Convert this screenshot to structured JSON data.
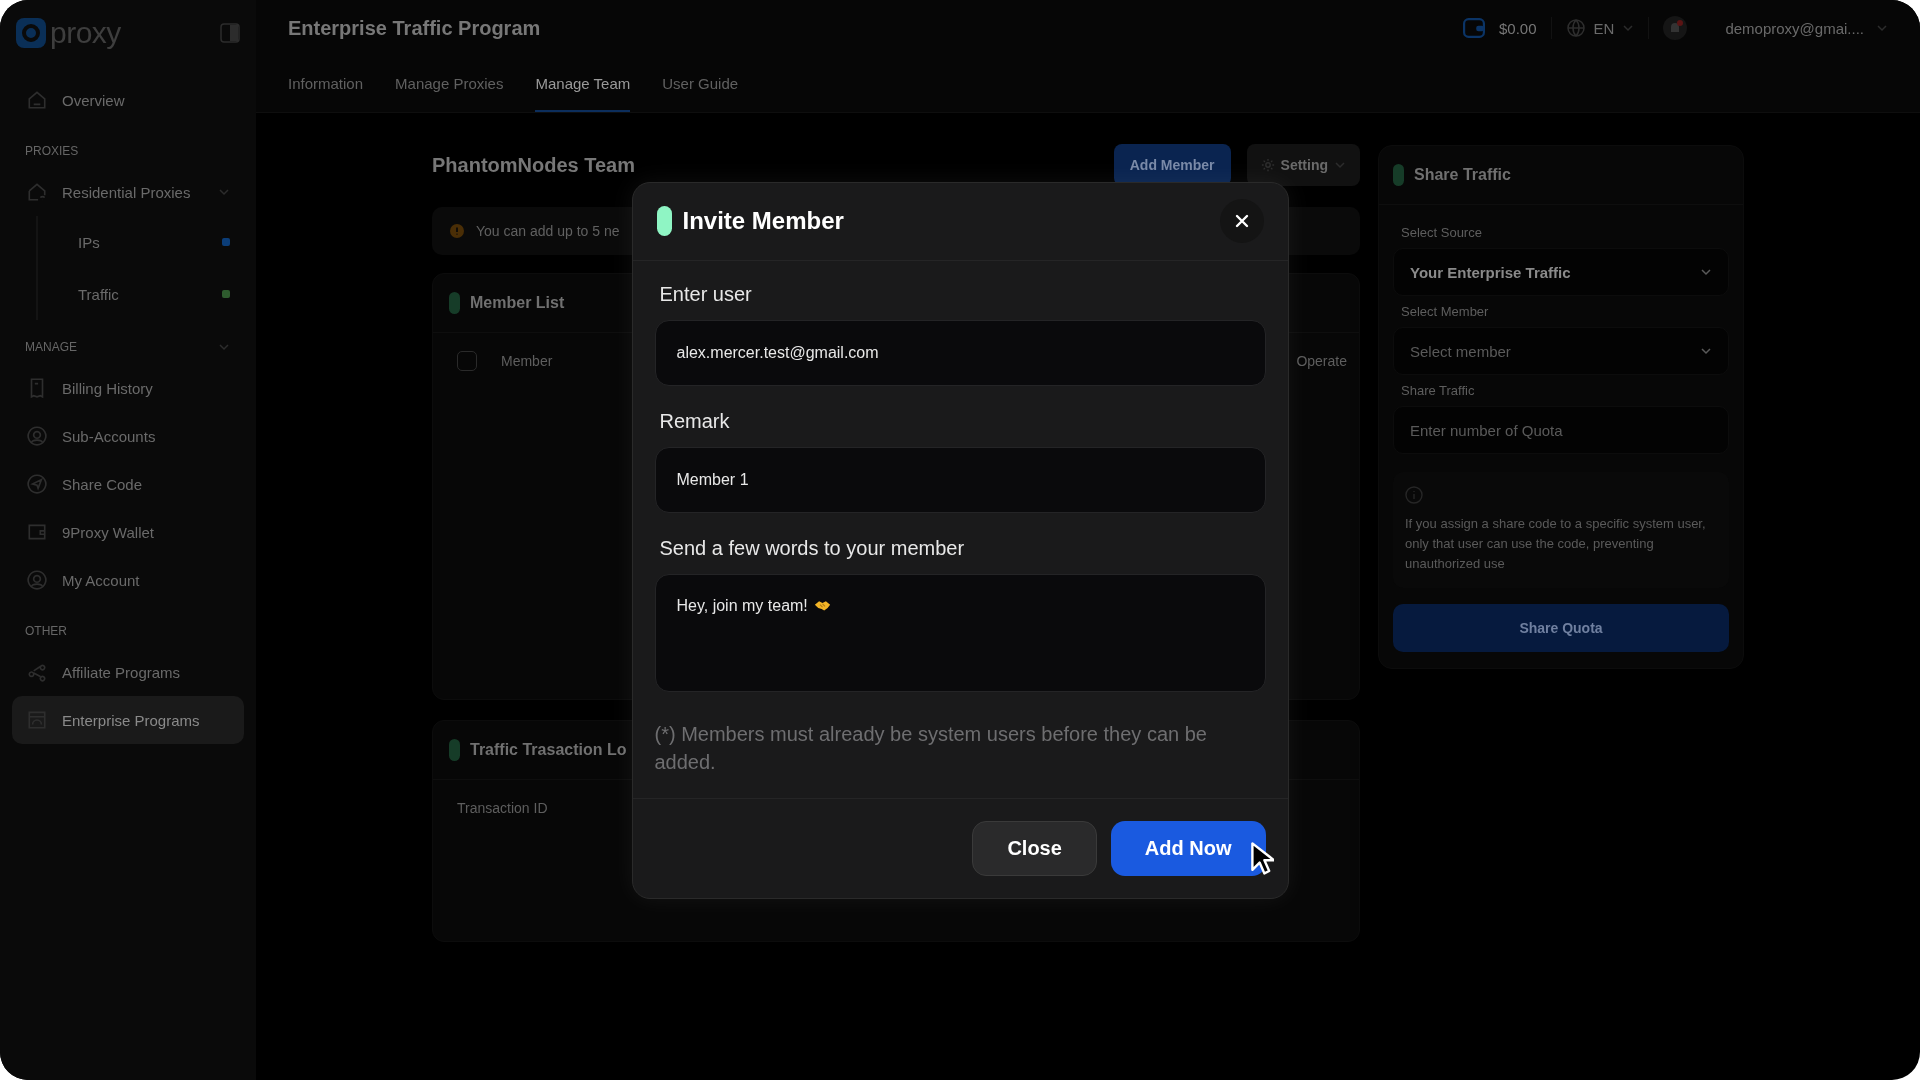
{
  "sidebar": {
    "logo": "proxy",
    "items": [
      {
        "kind": "item",
        "label": "Overview",
        "selected": false
      },
      {
        "kind": "section",
        "label": "PROXIES"
      },
      {
        "kind": "item",
        "label": "Residential Proxies",
        "selected": false,
        "expanded": true
      },
      {
        "kind": "subitem",
        "label": "IPs",
        "color": "#0b3d78"
      },
      {
        "kind": "subitem",
        "label": "Traffic",
        "color": "#2e5b2e"
      },
      {
        "kind": "section",
        "label": "MANAGE",
        "expanded": true
      },
      {
        "kind": "item",
        "label": "Billing History",
        "selected": false
      },
      {
        "kind": "item",
        "label": "Sub-Accounts",
        "selected": false
      },
      {
        "kind": "item",
        "label": "Share Code",
        "selected": false
      },
      {
        "kind": "item",
        "label": "9Proxy Wallet",
        "selected": false
      },
      {
        "kind": "item",
        "label": "My Account",
        "selected": false
      },
      {
        "kind": "section",
        "label": "OTHER"
      },
      {
        "kind": "item",
        "label": "Affiliate Programs",
        "selected": false
      },
      {
        "kind": "item",
        "label": "Enterprise Programs",
        "selected": true
      }
    ]
  },
  "header": {
    "title": "Enterprise Traffic Program",
    "balance": "$0.00",
    "language": "EN",
    "account": "demoproxy@gmai....",
    "tabs": [
      {
        "label": "Information",
        "selected": false
      },
      {
        "label": "Manage Proxies",
        "selected": false
      },
      {
        "label": "Manage Team",
        "selected": true
      },
      {
        "label": "User Guide",
        "selected": false
      }
    ]
  },
  "team": {
    "title": "PhantomNodes Team",
    "add_button": "Add Member",
    "setting_button": "Setting",
    "notice": "You can add up to 5 ne",
    "member_list": {
      "title": "Member List",
      "select_all": {
        "checked": false
      },
      "columns": [
        "Member",
        "Operate"
      ]
    },
    "transaction_log": {
      "title": "Traffic Trasaction Lo",
      "columns": [
        "Transaction ID"
      ]
    }
  },
  "share_panel": {
    "title": "Share Traffic",
    "fields": [
      {
        "kind": "select",
        "label": "Select Source",
        "value": "Your Enterprise Traffic"
      },
      {
        "kind": "select",
        "label": "Select Member",
        "placeholder": "Select member"
      },
      {
        "kind": "input",
        "label": "Share Traffic",
        "placeholder": "Enter number of Quota"
      }
    ],
    "info": "If you assign a share code to a specific system user, only that user can use the code, preventing unauthorized use",
    "button": "Share Quota"
  },
  "modal": {
    "title": "Invite Member",
    "fields": [
      {
        "kind": "input",
        "label": "Enter user",
        "value": "alex.mercer.test@gmail.com"
      },
      {
        "kind": "input",
        "label": "Remark",
        "value": "Member 1"
      },
      {
        "kind": "textarea",
        "label": "Send a few words to your member",
        "value": "Hey, join my team!"
      }
    ],
    "note": "(*) Members must already be system users before they can be added.",
    "buttons": [
      {
        "kind": "secondary",
        "label": "Close"
      },
      {
        "kind": "primary",
        "label": "Add Now"
      }
    ]
  }
}
